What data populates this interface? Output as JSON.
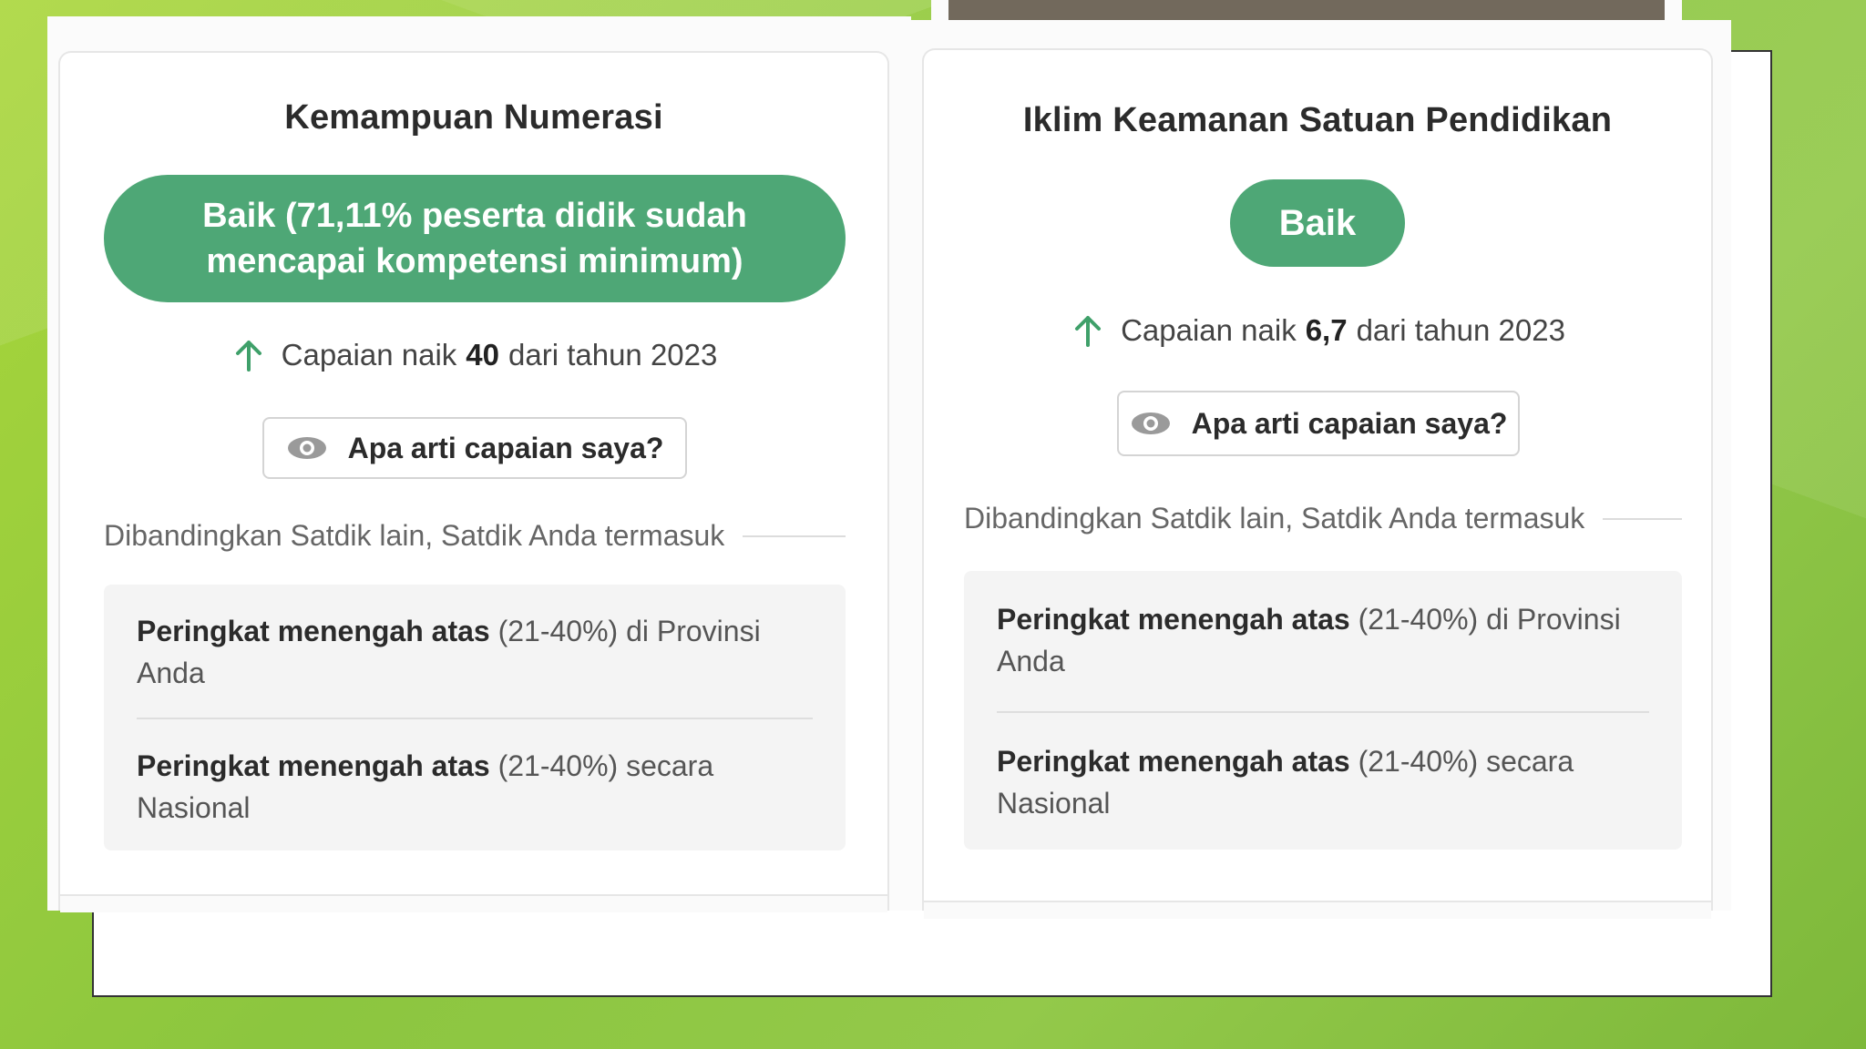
{
  "colors": {
    "accent_green": "#4ea776",
    "arrow_green": "#3fa06a",
    "background_lime": "#8cc63f"
  },
  "left_card": {
    "title": "Kemampuan Numerasi",
    "status_badge": "Baik (71,11% peserta didik sudah mencapai kompetensi minimum)",
    "trend": {
      "prefix": "Capaian naik",
      "value": "40",
      "suffix": "dari tahun 2023",
      "icon": "arrow-up-icon"
    },
    "info_button": {
      "icon": "eye-icon",
      "label": "Apa arti capaian saya?"
    },
    "compare_label": "Dibandingkan Satdik lain, Satdik Anda termasuk",
    "ranks": [
      {
        "bold": "Peringkat menengah atas",
        "rest": " (21-40%) di Provinsi Anda"
      },
      {
        "bold": "Peringkat menengah atas",
        "rest": " (21-40%) secara Nasional"
      }
    ]
  },
  "right_card": {
    "title": "Iklim Keamanan Satuan Pendidikan",
    "status_badge": "Baik",
    "trend": {
      "prefix": "Capaian naik",
      "value": "6,7",
      "suffix": "dari tahun 2023",
      "icon": "arrow-up-icon"
    },
    "info_button": {
      "icon": "eye-icon",
      "label": "Apa arti capaian saya?"
    },
    "compare_label": "Dibandingkan Satdik lain, Satdik Anda termasuk",
    "ranks": [
      {
        "bold": "Peringkat menengah atas",
        "rest": " (21-40%) di Provinsi Anda"
      },
      {
        "bold": "Peringkat menengah atas",
        "rest": " (21-40%) secara Nasional"
      }
    ]
  }
}
